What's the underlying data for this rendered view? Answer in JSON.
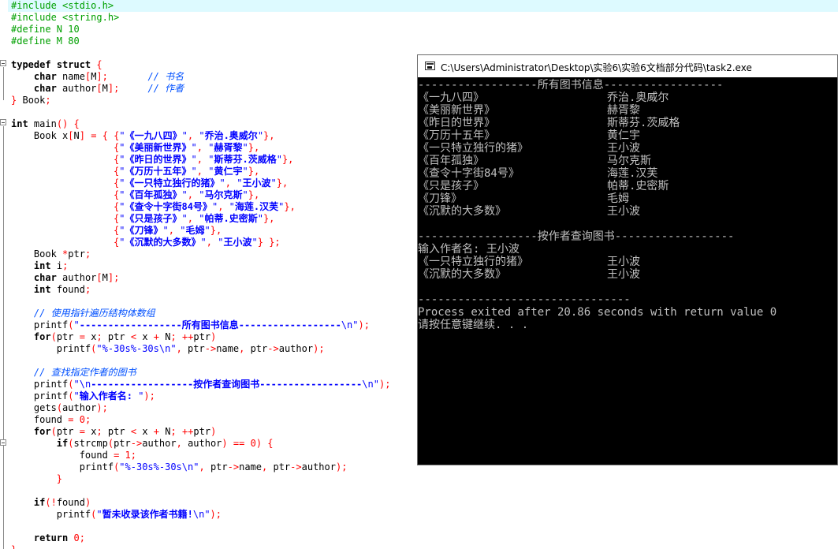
{
  "editor": {
    "code_lines": [
      "#include <stdio.h>",
      "#include <string.h>",
      "#define N 10",
      "#define M 80",
      "",
      "typedef struct {",
      "    char name[M];       // 书名",
      "    char author[M];     // 作者",
      "} Book;",
      "",
      "int main() {",
      "    Book x[N] = { {\"《一九八四》\", \"乔治.奥威尔\"},",
      "                  {\"《美丽新世界》\", \"赫胥黎\"},",
      "                  {\"《昨日的世界》\", \"斯蒂芬.茨威格\"},",
      "                  {\"《万历十五年》\", \"黄仁宇\"},",
      "                  {\"《一只特立独行的猪》\", \"王小波\"},",
      "                  {\"《百年孤独》\", \"马尔克斯\"},",
      "                  {\"《查令十字街84号》\", \"海莲.汉芙\"},",
      "                  {\"《只是孩子》\", \"帕蒂.史密斯\"},",
      "                  {\"《刀锋》\", \"毛姆\"},",
      "                  {\"《沉默的大多数》\", \"王小波\"} };",
      "    Book *ptr;",
      "    int i;",
      "    char author[M];",
      "    int found;",
      "",
      "    // 使用指针遍历结构体数组",
      "    printf(\"------------------所有图书信息------------------\\n\");",
      "    for(ptr = x; ptr < x + N; ++ptr)",
      "        printf(\"%-30s%-30s\\n\", ptr->name, ptr->author);",
      "",
      "    // 查找指定作者的图书",
      "    printf(\"\\n------------------按作者查询图书------------------\\n\");",
      "    printf(\"输入作者名: \");",
      "    gets(author);",
      "    found = 0;",
      "    for(ptr = x; ptr < x + N; ++ptr)",
      "        if(strcmp(ptr->author, author) == 0) {",
      "            found = 1;",
      "            printf(\"%-30s%-30s\\n\", ptr->name, ptr->author);",
      "        }",
      "",
      "    if(!found)",
      "        printf(\"暂未收录该作者书籍!\\n\");",
      "",
      "    return 0;",
      "}"
    ]
  },
  "console": {
    "title": "C:\\Users\\Administrator\\Desktop\\实验6\\实验6文档部分代码\\task2.exe",
    "header_all": "------------------所有图书信息------------------",
    "books": [
      {
        "name": "《一九八四》",
        "author": "乔治.奥威尔"
      },
      {
        "name": "《美丽新世界》",
        "author": "赫胥黎"
      },
      {
        "name": "《昨日的世界》",
        "author": "斯蒂芬.茨威格"
      },
      {
        "name": "《万历十五年》",
        "author": "黄仁宇"
      },
      {
        "name": "《一只特立独行的猪》",
        "author": "王小波"
      },
      {
        "name": "《百年孤独》",
        "author": "马尔克斯"
      },
      {
        "name": "《查令十字街84号》",
        "author": "海莲.汉芙"
      },
      {
        "name": "《只是孩子》",
        "author": "帕蒂.史密斯"
      },
      {
        "name": "《刀锋》",
        "author": "毛姆"
      },
      {
        "name": "《沉默的大多数》",
        "author": "王小波"
      }
    ],
    "header_query": "------------------按作者查询图书------------------",
    "prompt": "输入作者名: 王小波",
    "results": [
      {
        "name": "《一只特立独行的猪》",
        "author": "王小波"
      },
      {
        "name": "《沉默的大多数》",
        "author": "王小波"
      }
    ],
    "separator": "--------------------------------",
    "exit_message": "Process exited after 20.86 seconds with return value 0",
    "continue_message": "请按任意键继续. . ."
  }
}
